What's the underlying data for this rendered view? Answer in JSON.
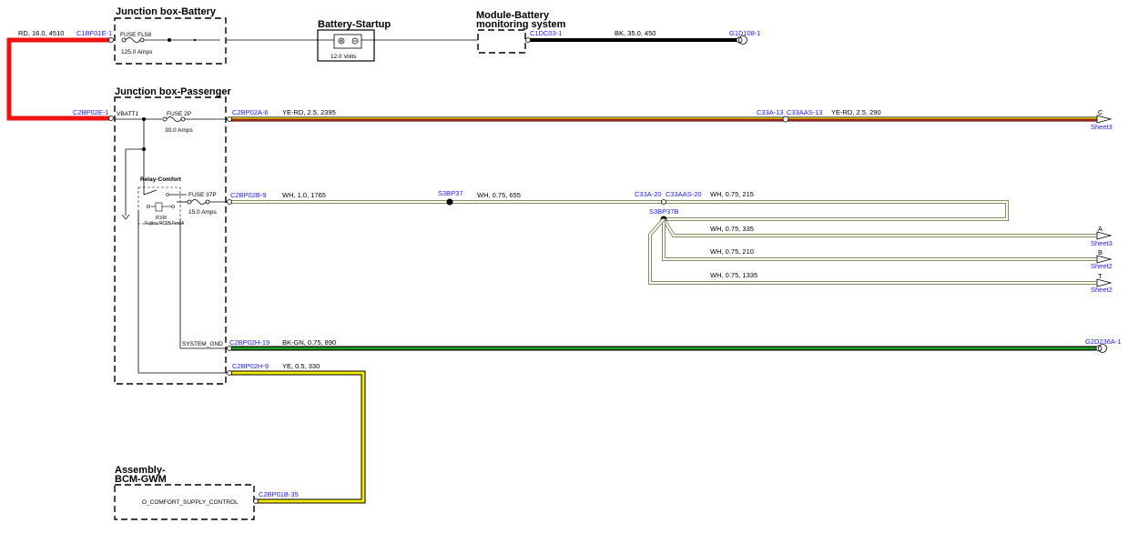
{
  "boxes": {
    "jb_battery": "Junction box-Battery",
    "battery_startup": "Battery-Startup",
    "mbms_line1": "Module-Battery",
    "mbms_line2": "monitoring system",
    "jb_passenger": "Junction box-Passenger",
    "bcm_line1": "Assembly-",
    "bcm_line2": "BCM-GWM"
  },
  "components": {
    "fuse_fl58": "FUSE FL58",
    "fuse_fl58_rating": "125.0 Amps",
    "battery_voltage": "12.0 Volts",
    "fuse_2p": "FUSE 2P",
    "fuse_2p_rating": "30.0 Amps",
    "fuse_37p": "FUSE 37P",
    "fuse_37p_rating": "15.0 Amps",
    "relay_comfort": "Relay-Comfort",
    "relay_id": "R108",
    "relay_desc": "Fujitsu PC05 FmnA",
    "vbatt": "VBATT1",
    "system_gnd": "SYSTEM_GND",
    "bcm_pin": "O_COMFORT_SUPPLY_CONTROL"
  },
  "connectors": {
    "c1bf01e": "C1BF01E-1",
    "c1dc03": "C1DC03-1",
    "g1d108": "G1D108-1",
    "c2bp02e": "C2BP02E-1",
    "c2bp02a": "C2BP02A-6",
    "c33a13": "C33A-13",
    "c33aas13": "C33AAS-13",
    "c2bp02b": "C2BP02B-9",
    "s3bp37": "S3BP37",
    "c33a20": "C33A-20",
    "c33aas20": "C33AAS-20",
    "s3bp37b": "S3BP37B",
    "c2bp02h19": "C2BP02H-19",
    "g2d236a": "G2D236A-1",
    "c2bp02h9": "C2BP02H-9",
    "c2bp01b": "C2BP01B-35"
  },
  "wires": {
    "rd_16": "RD,  16.0,  4510",
    "bk_35": "BK,  35.0,  450",
    "yerd_left": "YE-RD,  2.5,  2395",
    "yerd_right": "YE-RD,  2.5,  290",
    "wh_1765": "WH,  1.0,  1765",
    "wh_655": "WH,  0.75,  655",
    "wh_215": "WH,  0.75,  215",
    "wh_335": "WH,  0.75,  335",
    "wh_210": "WH,  0.75,  210",
    "wh_1335": "WH,  0.75,  1335",
    "bkgn_890": "BK-GN,  0.75,  890",
    "ye_330": "YE,  0.5,  330"
  },
  "offsheet": {
    "c_letter": "C",
    "c_sheet": "Sheet3",
    "a_letter": "A",
    "a_sheet": "Sheet3",
    "b_letter": "B",
    "b_sheet": "Sheet2",
    "t_letter": "T",
    "t_sheet": "Sheet2"
  },
  "colors": {
    "red": "#ee1111",
    "black": "#000000",
    "yellow": "#f2ea00",
    "ye_rd_red": "#e02020",
    "ye_rd_yellow": "#f0e000",
    "white_wire_border": "#8a8a60",
    "green": "#1fa81f",
    "connector_blue": "#1a1aff"
  }
}
